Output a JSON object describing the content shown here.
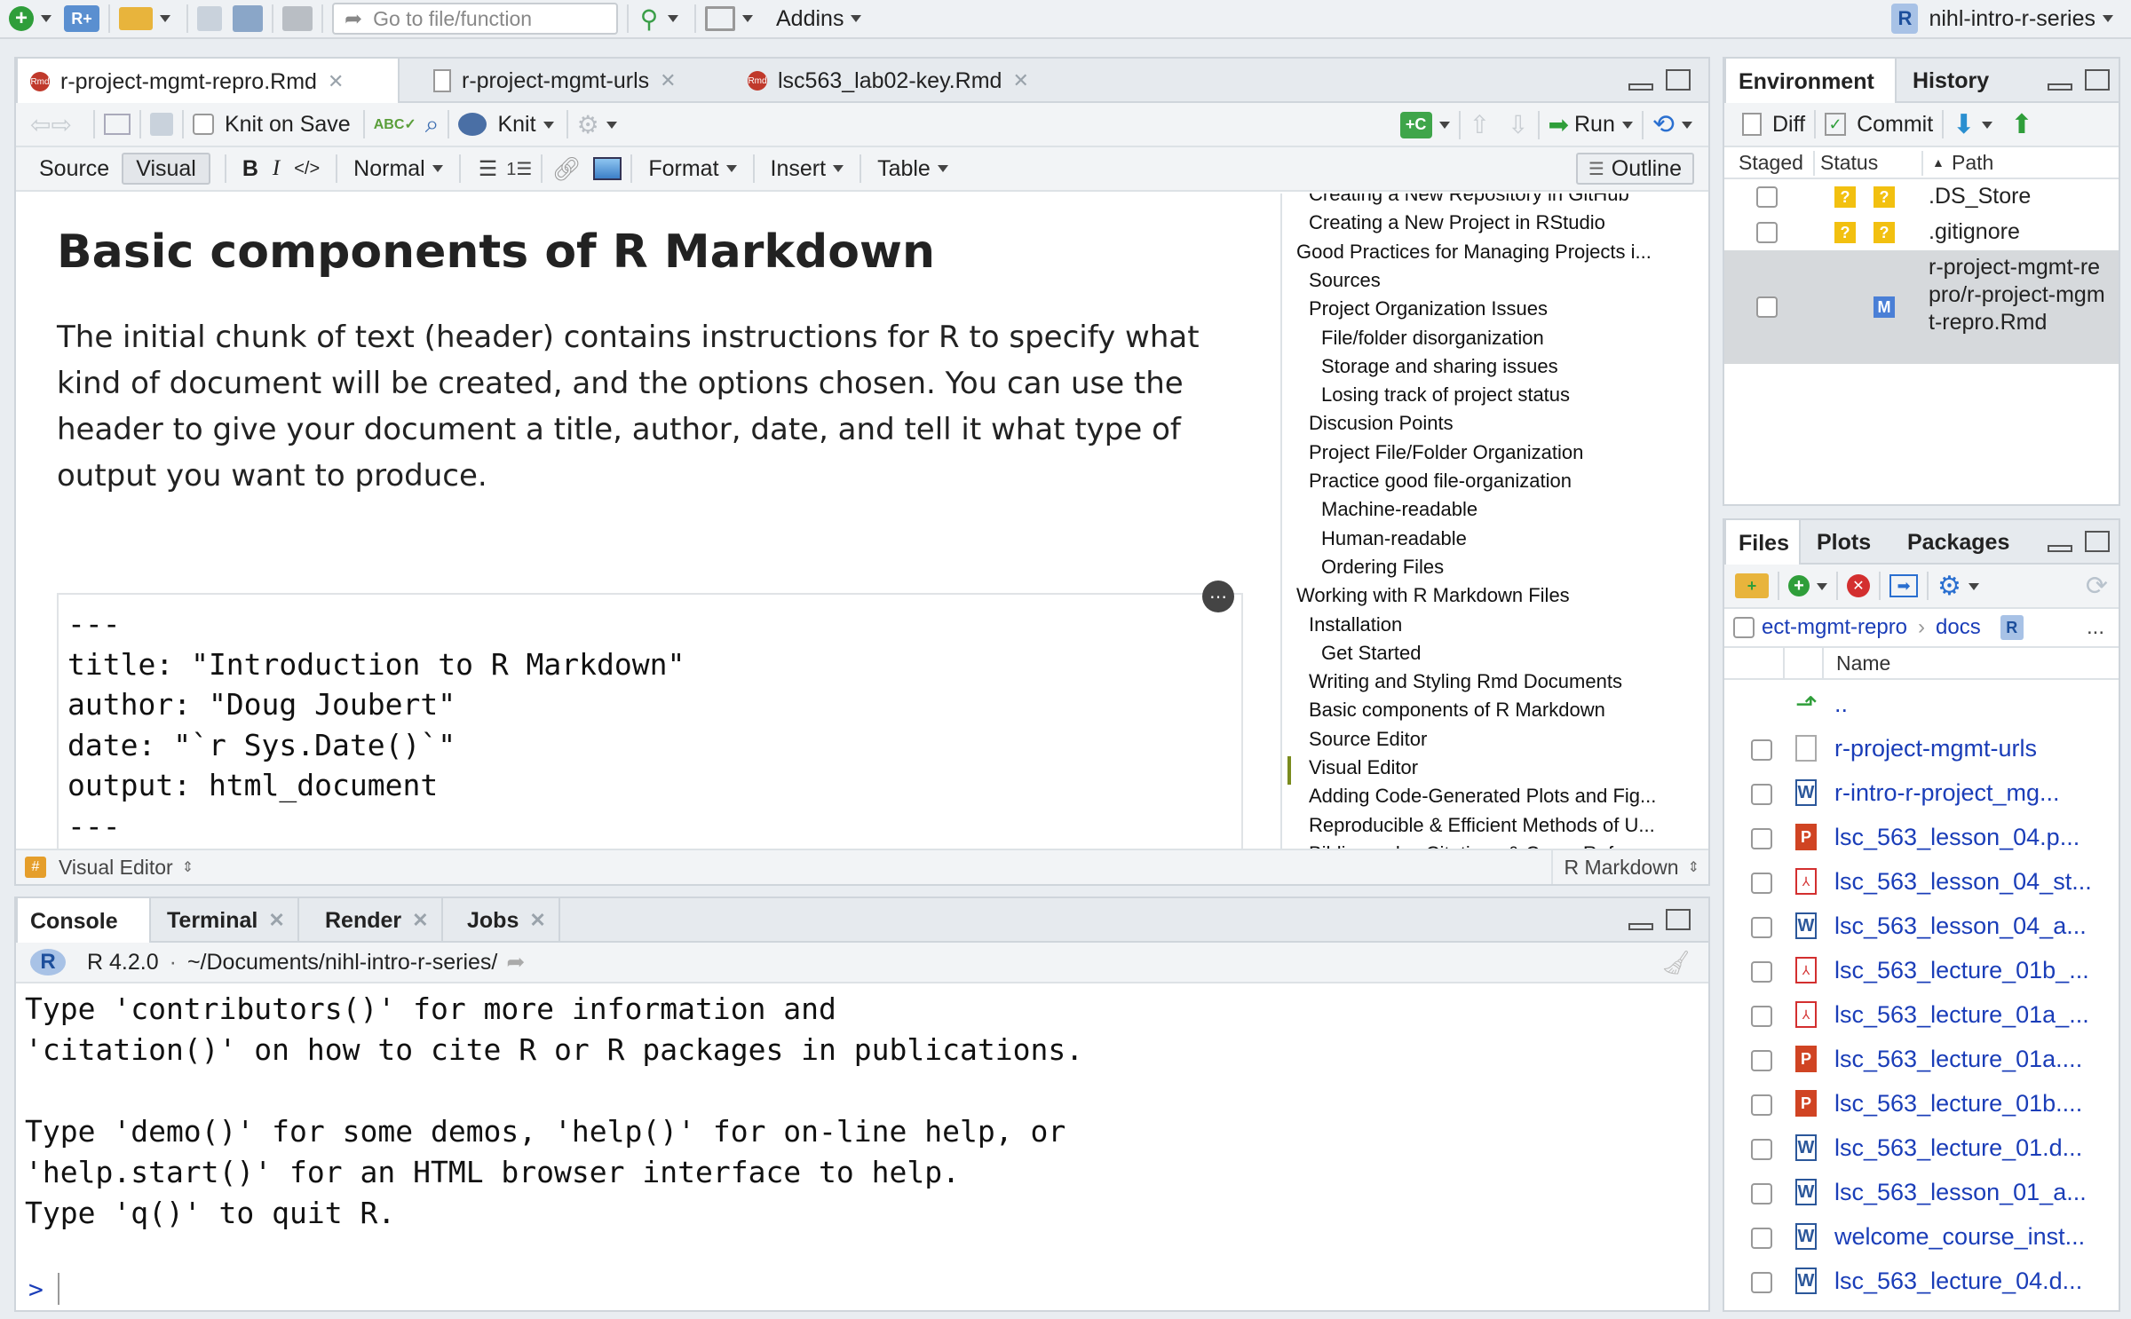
{
  "main_toolbar": {
    "goto_placeholder": "Go to file/function",
    "addins_label": "Addins",
    "project_label": "nihl-intro-r-series"
  },
  "editor": {
    "tabs": [
      {
        "label": "r-project-mgmt-repro.Rmd"
      },
      {
        "label": "r-project-mgmt-urls"
      },
      {
        "label": "lsc563_lab02-key.Rmd"
      }
    ],
    "knit_on_save_label": "Knit on Save",
    "knit_label": "Knit",
    "run_label": "Run",
    "mode_source": "Source",
    "mode_visual": "Visual",
    "bold_label": "B",
    "italic_label": "I",
    "code_label": "</>",
    "style_select": "Normal",
    "format_menu": "Format",
    "insert_menu": "Insert",
    "table_menu": "Table",
    "outline_button": "Outline",
    "heading": "Basic components of R Markdown",
    "paragraph": "The initial chunk of text (header) contains instructions for R to specify what kind of document will be created, and the options chosen. You can use the header to give your document a title, author, date, and tell it what type of output you want to produce.",
    "code_lines": [
      "---",
      "title: \"Introduction to R Markdown\"",
      "author: \"Doug Joubert\"",
      "date: \"`r Sys.Date()`\"",
      "output: html_document",
      "---"
    ],
    "status_left": "Visual Editor",
    "status_right": "R Markdown"
  },
  "outline": {
    "items": [
      {
        "label": "Creating a New Repository in GitHub",
        "level": 2
      },
      {
        "label": "Creating a New Project in RStudio",
        "level": 2
      },
      {
        "label": "Good Practices for Managing Projects i...",
        "level": 1
      },
      {
        "label": "Sources",
        "level": 2
      },
      {
        "label": "Project Organization Issues",
        "level": 2
      },
      {
        "label": "File/folder disorganization",
        "level": 3
      },
      {
        "label": "Storage and sharing issues",
        "level": 3
      },
      {
        "label": "Losing track of project status",
        "level": 3
      },
      {
        "label": "Discusion Points",
        "level": 2
      },
      {
        "label": "Project File/Folder Organization",
        "level": 2
      },
      {
        "label": "Practice good file-organization",
        "level": 2
      },
      {
        "label": "Machine-readable",
        "level": 3
      },
      {
        "label": "Human-readable",
        "level": 3
      },
      {
        "label": "Ordering Files",
        "level": 3
      },
      {
        "label": "Working with R Markdown Files",
        "level": 1
      },
      {
        "label": "Installation",
        "level": 2
      },
      {
        "label": "Get Started",
        "level": 3
      },
      {
        "label": "Writing and Styling Rmd Documents",
        "level": 2
      },
      {
        "label": "Basic components of R Markdown",
        "level": 2
      },
      {
        "label": "Source Editor",
        "level": 2
      },
      {
        "label": "Visual Editor",
        "level": 2,
        "current": true
      },
      {
        "label": "Adding Code-Generated Plots and Fig...",
        "level": 2
      },
      {
        "label": "Reproducible & Efficient Methods of U...",
        "level": 2
      },
      {
        "label": "Bibliography, Citations & Cross-Ref...",
        "level": 2
      }
    ]
  },
  "console": {
    "tabs": [
      {
        "label": "Console"
      },
      {
        "label": "Terminal"
      },
      {
        "label": "Render"
      },
      {
        "label": "Jobs"
      }
    ],
    "r_version": "R 4.2.0",
    "path": "~/Documents/nihl-intro-r-series/",
    "lines": [
      "Type 'contributors()' for more information and",
      "'citation()' on how to cite R or R packages in publications.",
      "",
      "Type 'demo()' for some demos, 'help()' for on-line help, or",
      "'help.start()' for an HTML browser interface to help.",
      "Type 'q()' to quit R."
    ],
    "prompt": ">"
  },
  "env_pane": {
    "tabs": [
      {
        "label": "Environment"
      },
      {
        "label": "History"
      }
    ],
    "diff_label": "Diff",
    "commit_label": "Commit",
    "col_staged": "Staged",
    "col_status": "Status",
    "col_path": "Path",
    "rows": [
      {
        "path": ".DS_Store",
        "status": "?",
        "status2": "?"
      },
      {
        "path": ".gitignore",
        "status": "?",
        "status2": "?"
      },
      {
        "path": "r-project-mgmt-repro/r-project-mgmt-repro.Rmd",
        "status": "",
        "status2": "M"
      }
    ]
  },
  "files_pane": {
    "tabs": [
      {
        "label": "Files"
      },
      {
        "label": "Plots"
      },
      {
        "label": "Packages"
      }
    ],
    "crumb_1": "ect-mgmt-repro",
    "crumb_2": "docs",
    "more_label": "...",
    "col_name": "Name",
    "up_label": "..",
    "files": [
      {
        "name": "r-project-mgmt-urls",
        "icon": "blank-file-icon"
      },
      {
        "name": "r-intro-r-project_mg...",
        "icon": "word-doc-icon"
      },
      {
        "name": "lsc_563_lesson_04.p...",
        "icon": "powerpoint-icon"
      },
      {
        "name": "lsc_563_lesson_04_st...",
        "icon": "pdf-icon"
      },
      {
        "name": "lsc_563_lesson_04_a...",
        "icon": "word-doc-icon"
      },
      {
        "name": "lsc_563_lecture_01b_...",
        "icon": "pdf-icon"
      },
      {
        "name": "lsc_563_lecture_01a_...",
        "icon": "pdf-icon"
      },
      {
        "name": "lsc_563_lecture_01a....",
        "icon": "powerpoint-icon"
      },
      {
        "name": "lsc_563_lecture_01b....",
        "icon": "powerpoint-icon"
      },
      {
        "name": "lsc_563_lecture_01.d...",
        "icon": "word-doc-icon"
      },
      {
        "name": "lsc_563_lesson_01_a...",
        "icon": "word-doc-icon"
      },
      {
        "name": "welcome_course_inst...",
        "icon": "word-doc-icon"
      },
      {
        "name": "lsc_563_lecture_04.d...",
        "icon": "word-doc-icon"
      }
    ]
  },
  "colors": {
    "accent": "#1a3db8",
    "outline_marker": "#7a8b1e",
    "git_unknown": "#f2c010",
    "git_modified": "#4a7fd6"
  }
}
